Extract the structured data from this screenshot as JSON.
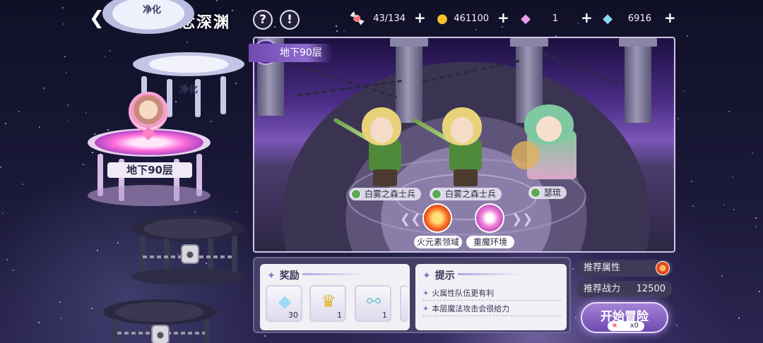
{
  "header": {
    "title": "恶念深渊",
    "help_icon": "question-icon",
    "info_icon": "exclamation-icon"
  },
  "resources": [
    {
      "name": "candy",
      "icon": "candy-icon",
      "value": "43/134"
    },
    {
      "name": "gold",
      "icon": "coin-icon",
      "value": "461100"
    },
    {
      "name": "gem_pink",
      "icon": "pink-gem-icon",
      "value": "1"
    },
    {
      "name": "gem_blue",
      "icon": "blue-gem-icon",
      "value": "6916"
    }
  ],
  "tower": {
    "floors": [
      {
        "label": "净化",
        "state": "cleared"
      },
      {
        "label": "净化",
        "state": "cleared"
      },
      {
        "label": "地下90层",
        "state": "current"
      },
      {
        "label": "",
        "state": "locked"
      },
      {
        "label": "",
        "state": "locked"
      }
    ]
  },
  "stage": {
    "tag": "地下90层",
    "enemies": [
      {
        "name": "白雾之森士兵",
        "element": "wind"
      },
      {
        "name": "白雾之森士兵",
        "element": "wind"
      },
      {
        "name": "瑟琉",
        "element": "wind"
      }
    ],
    "buffs": [
      {
        "label": "火元素领域",
        "icon": "fire-orb-icon"
      },
      {
        "label": "重魔环境",
        "icon": "magic-staff-icon"
      }
    ]
  },
  "rewards": {
    "title": "奖励",
    "items": [
      {
        "icon": "diamond-icon",
        "count": "30"
      },
      {
        "icon": "golden-trophy-icon",
        "count": "1"
      },
      {
        "icon": "potion-icon",
        "count": "1"
      }
    ]
  },
  "hints": {
    "title": "提示",
    "lines": [
      "火属性队伍更有利",
      "本层魔法攻击会很给力"
    ]
  },
  "recommend": {
    "attr_label": "推荐属性",
    "attr_icon": "fire-element-icon",
    "power_label": "推荐战力",
    "power_value": "12500"
  },
  "start": {
    "label": "开始冒险",
    "cost": "x0"
  },
  "colors": {
    "accent": "#8f6cd0",
    "panel": "#453f66",
    "fire": "#e4471d",
    "wind": "#5ea85a"
  }
}
